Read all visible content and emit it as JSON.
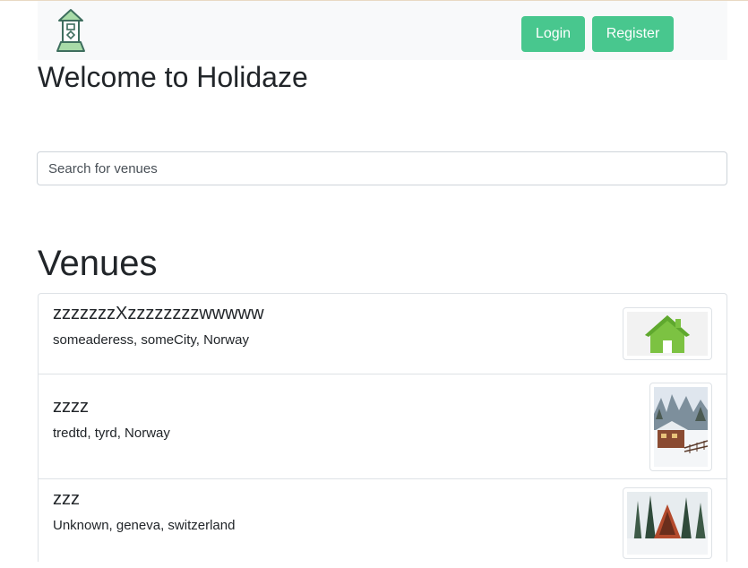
{
  "header": {
    "logo_icon": "house-tower-icon",
    "login_label": "Login",
    "register_label": "Register",
    "accent_color": "#48c78e"
  },
  "welcome": {
    "title": "Welcome to Holidaze"
  },
  "search": {
    "placeholder": "Search for venues",
    "value": ""
  },
  "venues": {
    "title": "Venues",
    "items": [
      {
        "name": "zzzzzzzXzzzzzzzzwwwww",
        "address": "someaderess, someCity, Norway",
        "image": "green-house-icon"
      },
      {
        "name": "zzzz",
        "address": "tredtd, tyrd, Norway",
        "image": "snowy-cabin-photo"
      },
      {
        "name": "zzz",
        "address": "Unknown, geneva, switzerland",
        "image": "a-frame-cabin-photo"
      }
    ]
  }
}
